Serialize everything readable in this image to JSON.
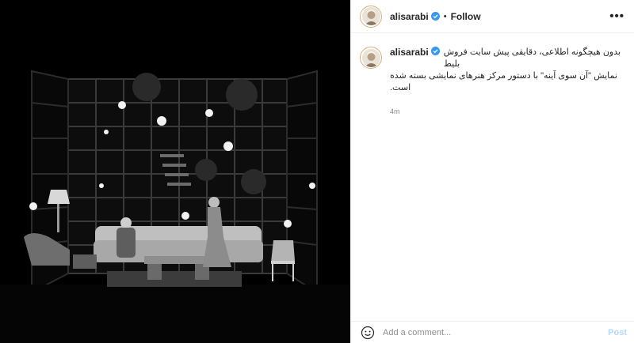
{
  "header": {
    "username": "alisarabi",
    "separator": "•",
    "follow_label": "Follow",
    "more_label": "•••",
    "verified_icon": "verified-badge-icon",
    "verified_color": "#3897f0"
  },
  "caption": {
    "username": "alisarabi",
    "line1": "بدون هیچگونه اطلاعی، دقایقی پیش سایت فروش بلیط",
    "line2": "نمایش \"آن سوی آینه\" با دستور مرکز هنرهای نمایشی بسته شده است.",
    "time": "4m"
  },
  "footer": {
    "emoji_icon": "smiley-icon",
    "placeholder": "Add a comment...",
    "post_label": "Post",
    "post_color": "#b3dbff"
  },
  "media": {
    "description_icon": "stage-photo"
  }
}
